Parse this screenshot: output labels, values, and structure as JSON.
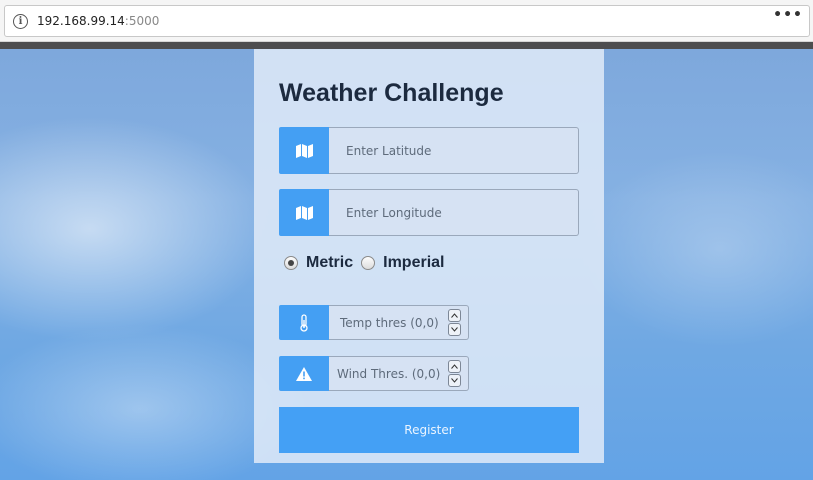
{
  "browser": {
    "url_host": "192.168.99.14",
    "url_port": ":5000"
  },
  "form": {
    "title": "Weather Challenge",
    "latitude": {
      "placeholder": "Enter Latitude",
      "icon": "map-icon"
    },
    "longitude": {
      "placeholder": "Enter Longitude",
      "icon": "map-icon"
    },
    "units": {
      "options": [
        "Metric",
        "Imperial"
      ],
      "selected": "Metric"
    },
    "temp_threshold": {
      "placeholder": "Temp thres (0,0)",
      "icon": "thermometer-icon"
    },
    "wind_threshold": {
      "placeholder": "Wind Thres. (0,0)",
      "icon": "warning-icon"
    },
    "register_label": "Register"
  },
  "colors": {
    "accent": "#449ff3",
    "title": "#1c2a3f"
  }
}
